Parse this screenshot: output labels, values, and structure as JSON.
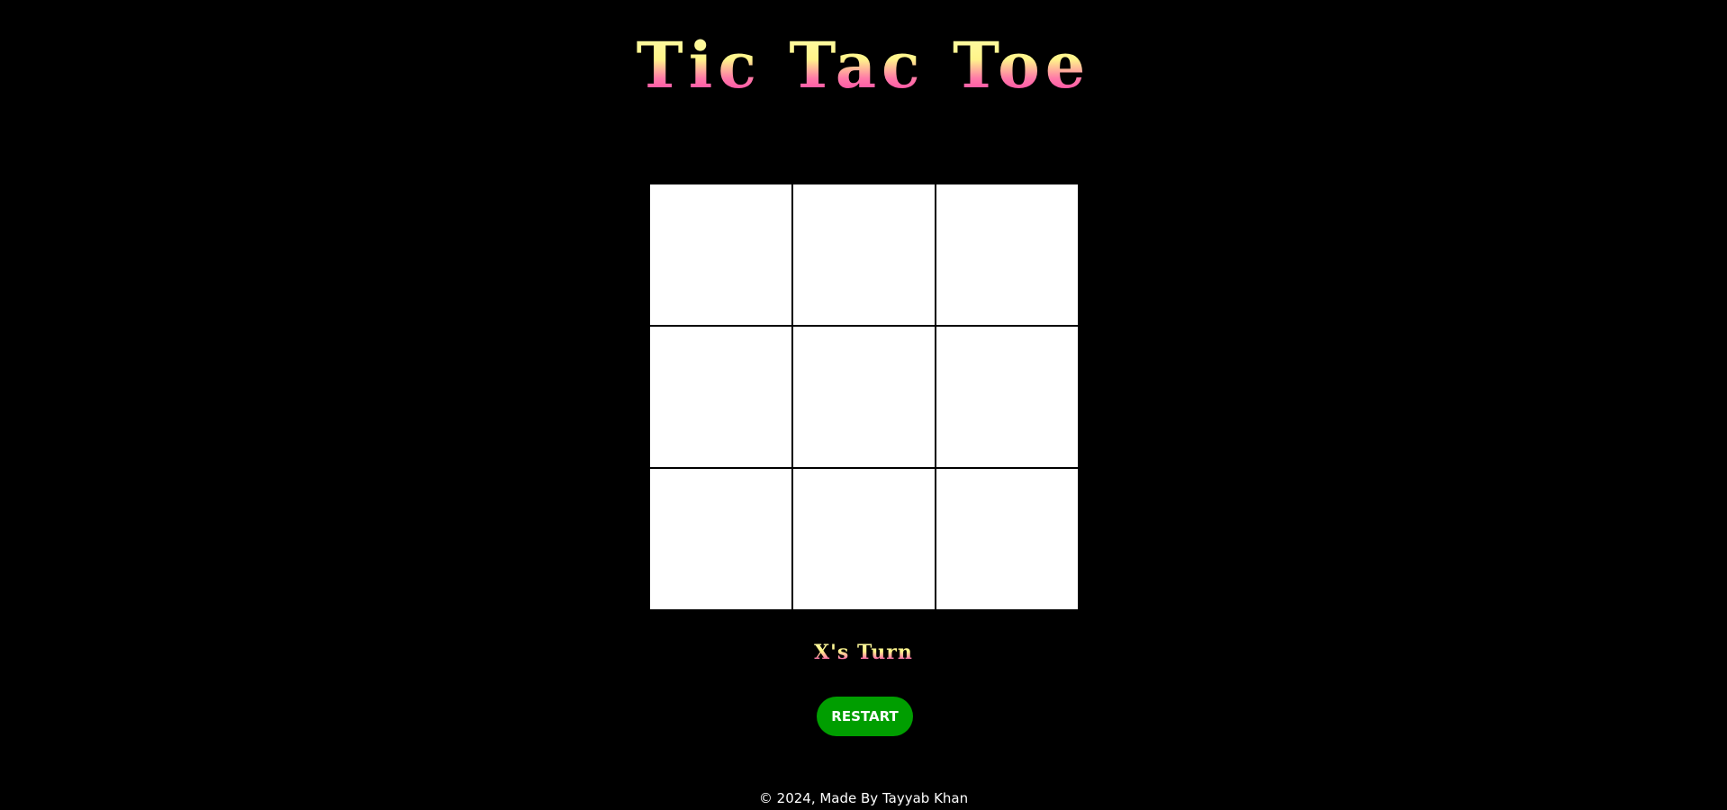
{
  "game": {
    "title": "Tic Tac Toe",
    "status": "X's Turn",
    "board": [
      "",
      "",
      "",
      "",
      "",
      "",
      "",
      "",
      ""
    ]
  },
  "controls": {
    "restart_label": "RESTART"
  },
  "footer": {
    "text": "© 2024, Made By Tayyab Khan"
  },
  "colors": {
    "background": "#000000",
    "cell": "#ffffff",
    "restart_button": "#009e00",
    "title_gradient_top": "#fffda6",
    "title_gradient_bottom": "#ff3fa6"
  }
}
